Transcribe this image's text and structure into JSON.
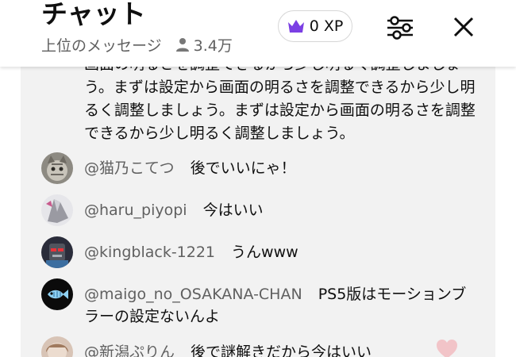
{
  "header": {
    "title": "チャット",
    "subtitle": "上位のメッセージ",
    "viewer_count": "3.4万",
    "xp_label": "0 XP",
    "accent_color": "#7b3fe4"
  },
  "pinned_message": "画面の明るさを調整できるから少し明るく調整しましょう。まずは設定から画面の明るさを調整できるから少し明るく調整しましょう。まずは設定から画面の明るさを調整できるから少し明るく調整しましょう。",
  "messages": [
    {
      "author": "@猫乃こてつ",
      "text": "後でいいにゃ！"
    },
    {
      "author": "@haru_piyopi",
      "text": "今はいい"
    },
    {
      "author": "@kingblack-1221",
      "text": "うんwww"
    },
    {
      "author": "@maigo_no_OSAKANA-CHAN",
      "text": "PS5版はモーションブラーの設定ないんよ"
    },
    {
      "author": "@新潟ぷりん",
      "text": "後で謎解きだから今はいい"
    }
  ],
  "icons": {
    "viewer": "person-icon",
    "xp": "crown-icon",
    "filter": "sliders-icon",
    "close": "close-icon",
    "reaction": "heart-icon"
  }
}
